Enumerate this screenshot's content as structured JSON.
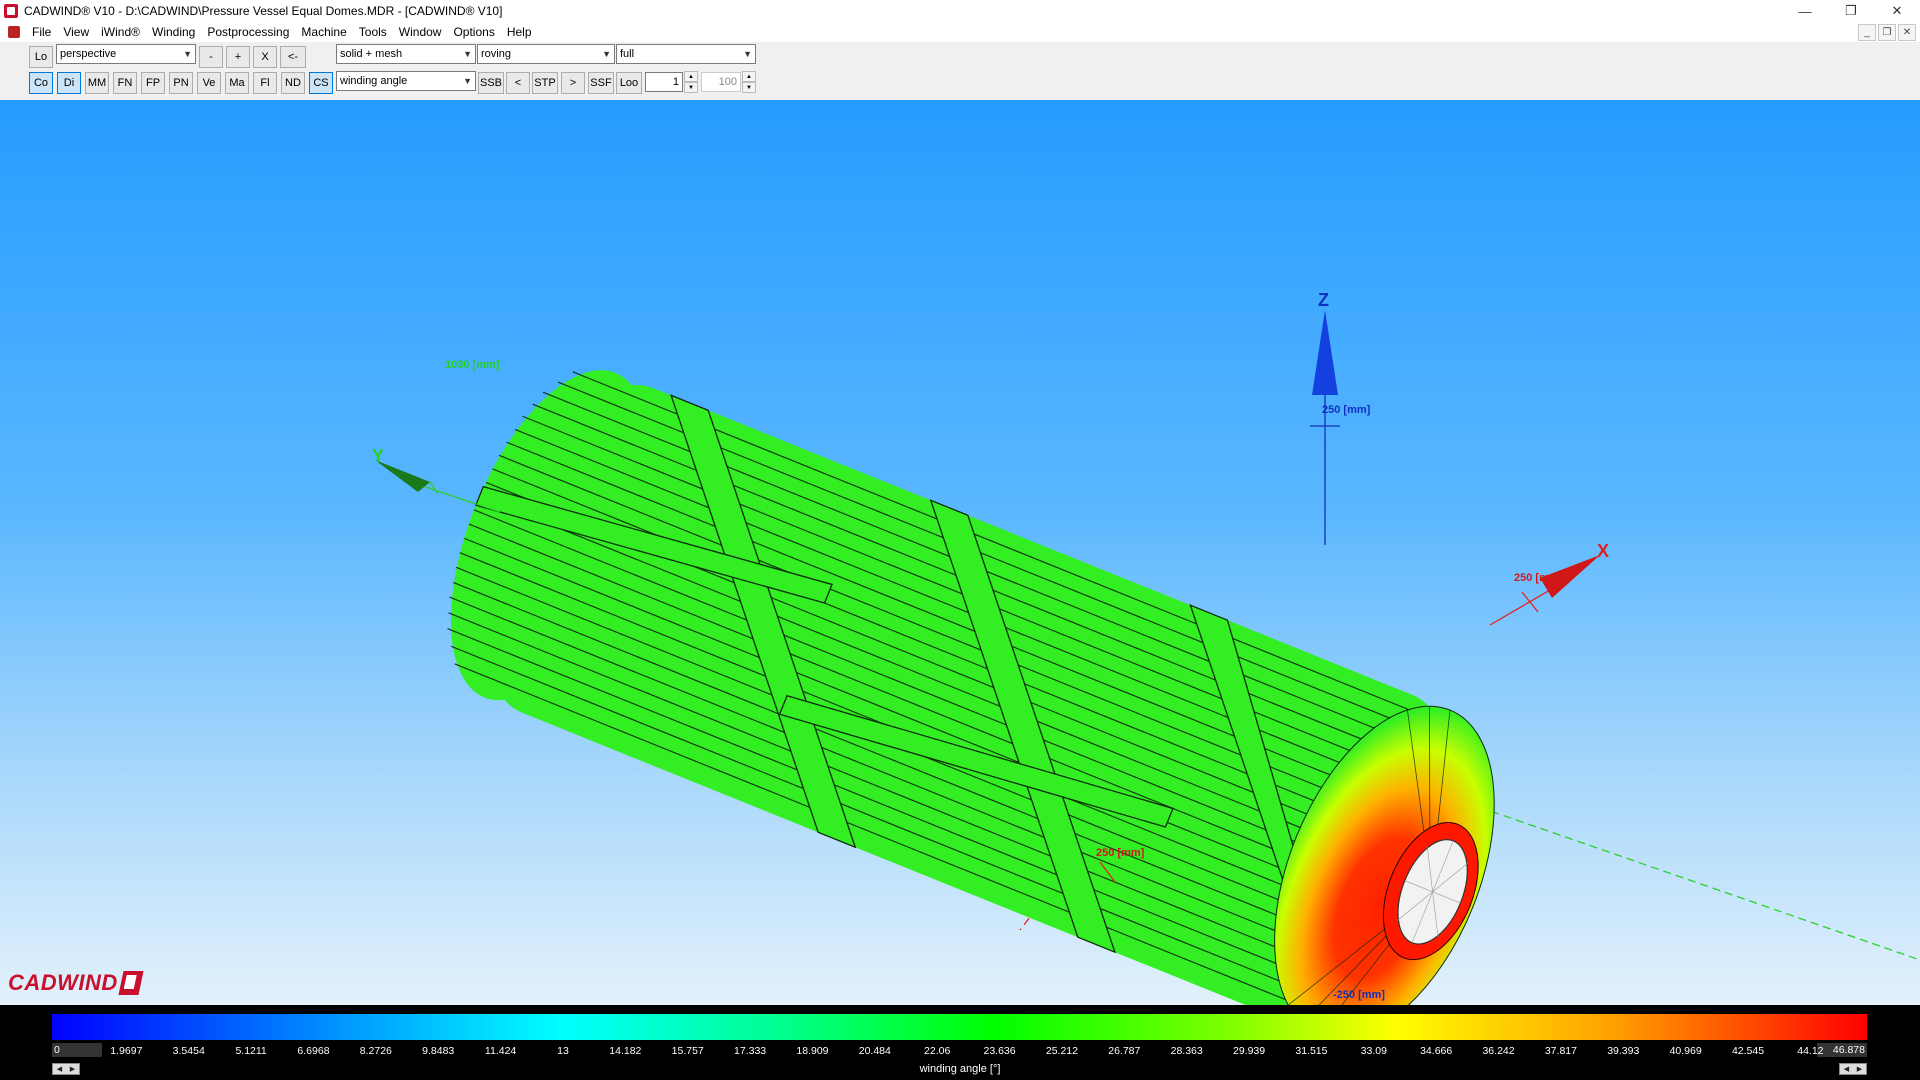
{
  "window": {
    "title": "CADWIND® V10  -  D:\\CADWIND\\Pressure Vessel Equal Domes.MDR - [CADWIND® V10]",
    "minimize": "—",
    "restore": "❐",
    "close": "✕"
  },
  "menu": {
    "items": [
      "File",
      "View",
      "iWind®",
      "Winding",
      "Postprocessing",
      "Machine",
      "Tools",
      "Window",
      "Options",
      "Help"
    ]
  },
  "toolbar": {
    "row1": {
      "lo": "Lo",
      "view_mode": "perspective",
      "zoom_out": "-",
      "zoom_in": "+",
      "x": "X",
      "back": "<-",
      "render_mode": "solid + mesh",
      "material": "roving",
      "range": "full"
    },
    "row2": {
      "buttons": [
        "Co",
        "Di",
        "MM",
        "FN",
        "FP",
        "PN",
        "Ve",
        "Ma",
        "Fl",
        "ND",
        "CS"
      ],
      "active": [
        "Co",
        "Di",
        "CS"
      ],
      "result_type": "winding angle",
      "buttons2": [
        "SSB",
        "<",
        "STP",
        ">",
        "SSF",
        "Loo"
      ],
      "step_value": "1",
      "max_value": "100"
    }
  },
  "viewport": {
    "axis_labels": {
      "x": "X",
      "y": "Y",
      "z": "Z"
    },
    "dimension_labels": {
      "y": "1030 [mm]",
      "z": "250 [mm]",
      "x": "250 [mm]",
      "neg_x": "250 [mm]",
      "neg_z": "-250 [mm]"
    },
    "logo": "CADWIND"
  },
  "legend": {
    "min": "0",
    "max": "46.878",
    "ticks": [
      "1.9697",
      "3.5454",
      "5.1211",
      "6.6968",
      "8.2726",
      "9.8483",
      "11.424",
      "13",
      "14.182",
      "15.757",
      "17.333",
      "18.909",
      "20.484",
      "22.06",
      "23.636",
      "25.212",
      "26.787",
      "28.363",
      "29.939",
      "31.515",
      "33.09",
      "34.666",
      "36.242",
      "37.817",
      "39.393",
      "40.969",
      "42.545",
      "44.12"
    ],
    "caption": "winding angle [°]",
    "colors": {
      "low": "#0000ff",
      "mid": "#00ff00",
      "high": "#ff0000"
    }
  }
}
